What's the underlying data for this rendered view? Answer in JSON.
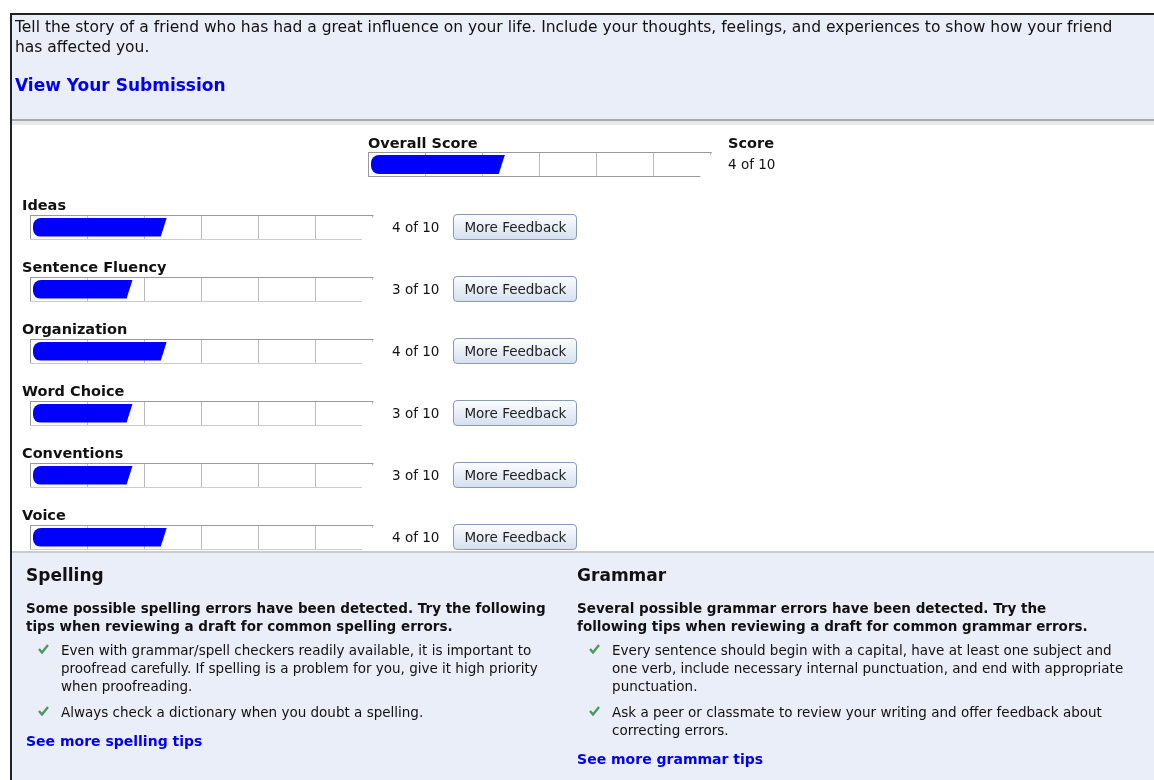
{
  "prompt": {
    "text": "Tell the story of a friend who has had a great influence on your life. Include your thoughts, feelings, and experiences to show how your friend has affected you.",
    "link": "View Your Submission"
  },
  "overall": {
    "label": "Overall Score",
    "level": 0.4,
    "score_heading": "Score",
    "score": "4 of 10"
  },
  "traits": [
    {
      "name": "Ideas",
      "level": 0.4,
      "score": "4 of 10",
      "button": "More Feedback"
    },
    {
      "name": "Sentence Fluency",
      "level": 0.3,
      "score": "3 of 10",
      "button": "More Feedback"
    },
    {
      "name": "Organization",
      "level": 0.4,
      "score": "4 of 10",
      "button": "More Feedback"
    },
    {
      "name": "Word Choice",
      "level": 0.3,
      "score": "3 of 10",
      "button": "More Feedback"
    },
    {
      "name": "Conventions",
      "level": 0.3,
      "score": "3 of 10",
      "button": "More Feedback"
    },
    {
      "name": "Voice",
      "level": 0.4,
      "score": "4 of 10",
      "button": "More Feedback"
    }
  ],
  "tips_sections": [
    {
      "title": "Spelling",
      "intro": "Some possible spelling errors have been detected. Try the following tips when reviewing a draft for common spelling errors.",
      "tips": [
        "Even with grammar/spell checkers readily available, it is important to proofread carefully. If spelling is a problem for you, give it high priority when proofreading.",
        "Always check a dictionary when you doubt a spelling."
      ],
      "link": "See more spelling tips"
    },
    {
      "title": "Grammar",
      "intro": "Several possible grammar errors have been detected. Try the following tips when reviewing a draft for common grammar errors.",
      "tips": [
        "Every sentence should begin with a capital, have at least one subject and one verb, include necessary internal punctuation, and end with appropriate punctuation.",
        "Ask a peer or classmate to review your writing and offer feedback about correcting errors."
      ],
      "link": "See more grammar tips"
    }
  ]
}
